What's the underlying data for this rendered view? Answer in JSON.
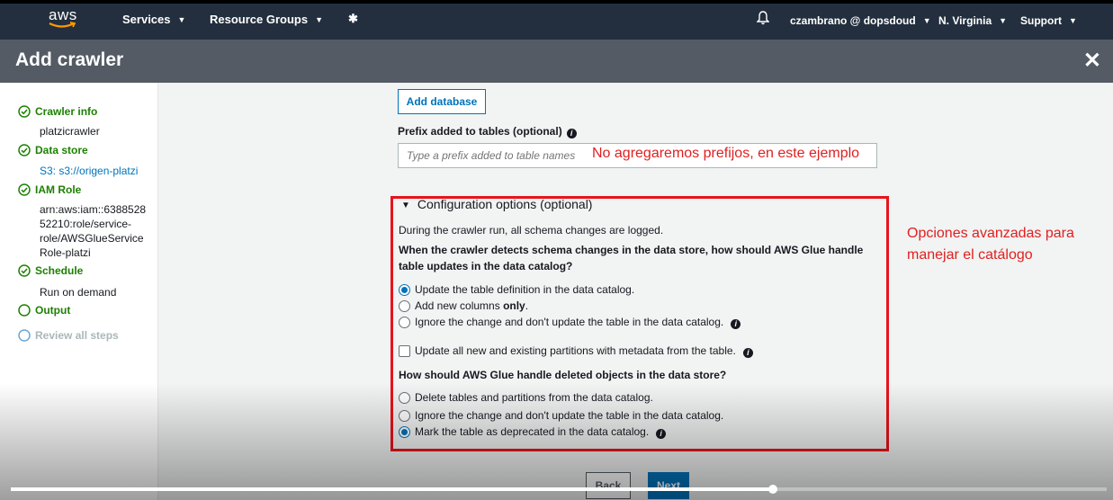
{
  "nav": {
    "logo_text": "aws",
    "services": "Services",
    "resource_groups": "Resource Groups",
    "user": "czambrano @ dopsdoud",
    "region": "N. Virginia",
    "support": "Support"
  },
  "title": {
    "text": "Add crawler",
    "close": "✕"
  },
  "sidebar": {
    "steps": [
      {
        "label": "Crawler info",
        "detail": [
          "platzicrawler"
        ],
        "status": "done"
      },
      {
        "label": "Data store",
        "detail": [
          "S3: s3://origen-platzi"
        ],
        "status": "done"
      },
      {
        "label": "IAM Role",
        "detail": [
          "arn:aws:iam::6388528",
          "52210:role/service-",
          "role/AWSGlueService",
          "Role-platzi"
        ],
        "status": "done"
      },
      {
        "label": "Schedule",
        "detail": [
          "Run on demand"
        ],
        "status": "done"
      },
      {
        "label": "Output",
        "detail": [],
        "status": "current"
      },
      {
        "label": "Review all steps",
        "detail": [],
        "status": "disabled"
      }
    ]
  },
  "main": {
    "add_database": "Add database",
    "prefix_label": "Prefix added to tables (optional)",
    "prefix_placeholder": "Type a prefix added to table names",
    "config_title": "Configuration options (optional)",
    "logged_text": "During the crawler run, all schema changes are logged.",
    "question1_line1": "When the crawler detects schema changes in the data store, how should AWS Glue handle",
    "question1_line2": "table updates in the data catalog?",
    "update_options": [
      {
        "label": "Update the table definition in the data catalog.",
        "checked": true
      },
      {
        "label_pre": "Add new columns ",
        "label_bold": "only",
        "label_post": ".",
        "checked": false
      },
      {
        "label": "Ignore the change and don't update the table in the data catalog.",
        "checked": false
      }
    ],
    "partitions_checkbox": "Update all new and existing partitions with metadata from the table.",
    "question2": "How should AWS Glue handle deleted objects in the data store?",
    "delete_options": [
      {
        "label": "Delete tables and partitions from the data catalog.",
        "checked": false
      },
      {
        "label": "Ignore the change and don't update the table in the data catalog.",
        "checked": false
      },
      {
        "label": "Mark the table as deprecated in the data catalog.",
        "checked": true
      }
    ],
    "back": "Back",
    "next": "Next"
  },
  "annotations": {
    "prefix_note": "No agregaremos prefijos, en este ejemplo",
    "options_note": "Opciones avanzadas para manejar el catálogo"
  },
  "video": {
    "progress": 0.695
  },
  "colors": {
    "nav_bg": "#232f3e",
    "title_bg": "#545b64",
    "accent": "#0073bb",
    "success": "#1d8102",
    "annotation": "#e02020"
  }
}
